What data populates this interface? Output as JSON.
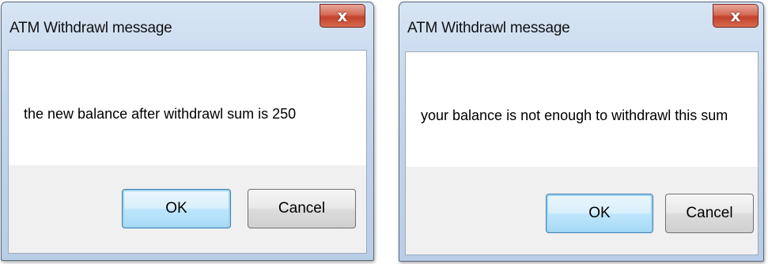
{
  "dialogs": [
    {
      "title": "ATM Withdrawl message",
      "close_glyph": "x",
      "message": "the new balance after withdrawl sum is 250",
      "ok_label": "OK",
      "cancel_label": "Cancel"
    },
    {
      "title": "ATM Withdrawl message",
      "close_glyph": "x",
      "message": "your balance is not enough to withdrawl this sum",
      "ok_label": "OK",
      "cancel_label": "Cancel"
    }
  ],
  "colors": {
    "close_button": "#c3412a",
    "default_button_border": "#3c7fb1",
    "frame": "#c2d5eb"
  },
  "icons": [
    "close-icon"
  ]
}
